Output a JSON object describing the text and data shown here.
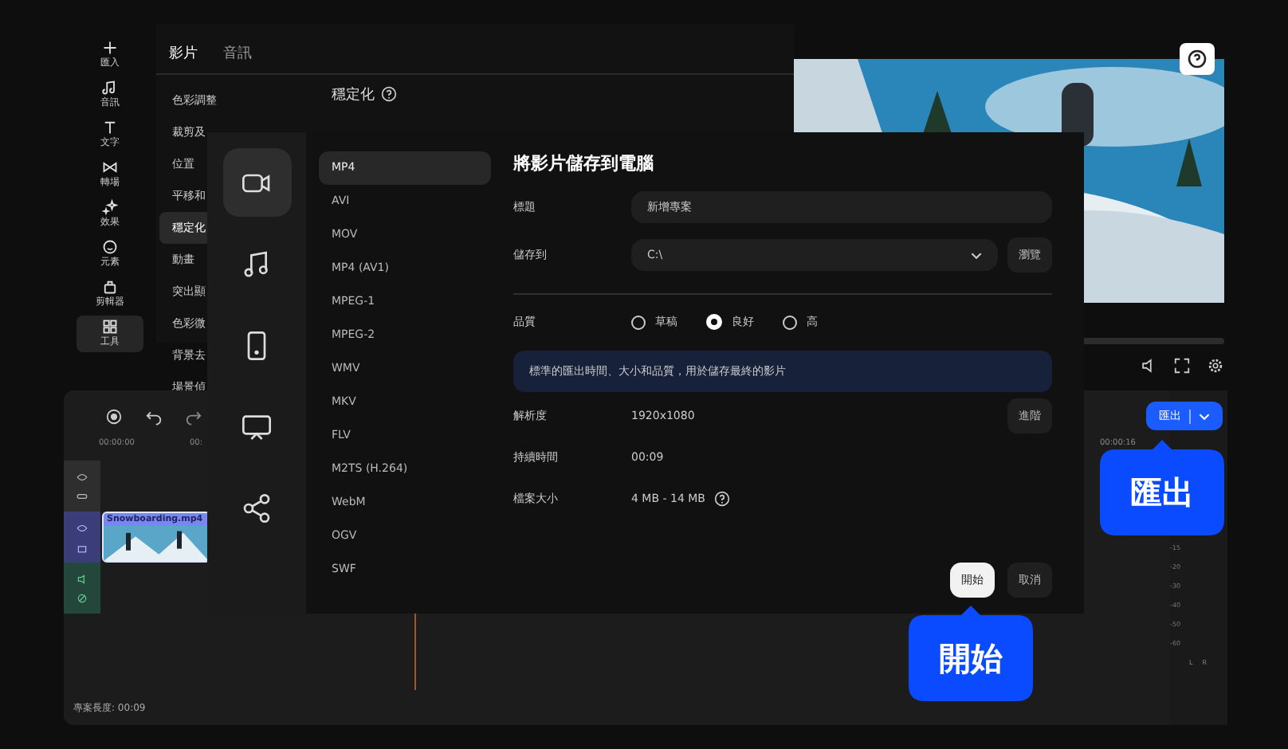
{
  "tool_rail": [
    {
      "kind": "plus",
      "label": "匯入",
      "selected": false
    },
    {
      "kind": "music",
      "label": "音訊",
      "selected": false
    },
    {
      "kind": "text",
      "label": "文字",
      "selected": false
    },
    {
      "kind": "transition",
      "label": "轉場",
      "selected": false
    },
    {
      "kind": "sparkle",
      "label": "效果",
      "selected": false
    },
    {
      "kind": "smile",
      "label": "元素",
      "selected": false
    },
    {
      "kind": "bag",
      "label": "剪輯器",
      "selected": false
    },
    {
      "kind": "grid",
      "label": "工具",
      "selected": true
    }
  ],
  "panel": {
    "tabs": [
      {
        "label": "影片",
        "selected": true
      },
      {
        "label": "音訊",
        "selected": false
      }
    ],
    "items": [
      {
        "label": "色彩調整",
        "selected": false
      },
      {
        "label": "裁剪及",
        "selected": false
      },
      {
        "label": "位置",
        "selected": false
      },
      {
        "label": "平移和",
        "selected": false
      },
      {
        "label": "穩定化",
        "selected": true
      },
      {
        "label": "動畫",
        "selected": false
      },
      {
        "label": "突出顯",
        "selected": false
      },
      {
        "label": "色彩微",
        "selected": false
      },
      {
        "label": "背景去",
        "selected": false
      },
      {
        "label": "場景偵",
        "selected": false
      }
    ],
    "heading": "穩定化"
  },
  "timeline": {
    "ruler": [
      "00:00:00",
      "00:",
      "00:00:16"
    ],
    "clip": "Snowboarding.mp4",
    "meter_ticks": [
      "-15",
      "-20",
      "-30",
      "-40",
      "-50",
      "-60"
    ],
    "meter_channels": [
      "L",
      "R"
    ],
    "status": "專案長度: 00:09"
  },
  "export_button": {
    "label": "匯出"
  },
  "dialog": {
    "categories": [
      {
        "kind": "video",
        "selected": true
      },
      {
        "kind": "audio",
        "selected": false
      },
      {
        "kind": "phone",
        "selected": false
      },
      {
        "kind": "tv",
        "selected": false
      },
      {
        "kind": "share",
        "selected": false
      }
    ],
    "formats": [
      {
        "label": "MP4",
        "selected": true
      },
      {
        "label": "AVI",
        "selected": false
      },
      {
        "label": "MOV",
        "selected": false
      },
      {
        "label": "MP4 (AV1)",
        "selected": false
      },
      {
        "label": "MPEG-1",
        "selected": false
      },
      {
        "label": "MPEG-2",
        "selected": false
      },
      {
        "label": "WMV",
        "selected": false
      },
      {
        "label": "MKV",
        "selected": false
      },
      {
        "label": "FLV",
        "selected": false
      },
      {
        "label": "M2TS (H.264)",
        "selected": false
      },
      {
        "label": "WebM",
        "selected": false
      },
      {
        "label": "OGV",
        "selected": false
      },
      {
        "label": "SWF",
        "selected": false
      }
    ],
    "title": "將影片儲存到電腦",
    "name_label": "標題",
    "name_value": "新增專案",
    "save_label": "儲存到",
    "save_value": "C:\\",
    "browse_button": "瀏覽",
    "quality": {
      "label": "品質",
      "options": [
        {
          "label": "草稿",
          "selected": false
        },
        {
          "label": "良好",
          "selected": true
        },
        {
          "label": "高",
          "selected": false
        }
      ]
    },
    "info": "標準的匯出時間、大小和品質，用於儲存最終的影片",
    "details": [
      {
        "label": "解析度",
        "value": "1920x1080"
      },
      {
        "label": "持續時間",
        "value": "00:09"
      },
      {
        "label": "檔案大小",
        "value": "4 MB - 14 MB"
      }
    ],
    "advanced_button": "進階",
    "start_button": "開始",
    "cancel_button": "取消"
  },
  "callouts": [
    {
      "label": "匯出"
    },
    {
      "label": "開始"
    }
  ]
}
